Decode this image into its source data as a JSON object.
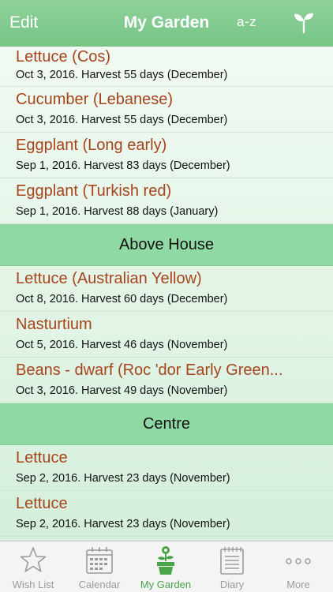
{
  "navbar": {
    "edit": "Edit",
    "title": "My Garden",
    "sort": "a-z"
  },
  "rows_top": [
    {
      "title": "Lettuce (Cos)",
      "sub": "Oct 3, 2016. Harvest 55 days (December)"
    },
    {
      "title": "Cucumber (Lebanese)",
      "sub": "Oct 3, 2016. Harvest 55 days (December)"
    },
    {
      "title": "Eggplant (Long early)",
      "sub": "Sep 1, 2016. Harvest 83 days (December)"
    },
    {
      "title": "Eggplant (Turkish red)",
      "sub": "Sep 1, 2016. Harvest 88 days (January)"
    }
  ],
  "section_above_house": {
    "header": "Above House",
    "rows": [
      {
        "title": "Lettuce (Australian Yellow)",
        "sub": "Oct 8, 2016. Harvest 60 days (December)"
      },
      {
        "title": "Nasturtium",
        "sub": "Oct 5, 2016. Harvest 46 days (November)"
      },
      {
        "title": "Beans - dwarf (Roc 'dor Early Green...",
        "sub": "Oct 3, 2016. Harvest 49 days (November)"
      }
    ]
  },
  "section_centre": {
    "header": "Centre",
    "rows": [
      {
        "title": "Lettuce",
        "sub": "Sep 2, 2016. Harvest 23 days (November)"
      },
      {
        "title": "Lettuce",
        "sub": "Sep 2, 2016. Harvest 23 days (November)"
      }
    ]
  },
  "tabs": [
    {
      "label": "Wish List",
      "icon": "star-icon"
    },
    {
      "label": "Calendar",
      "icon": "calendar-icon"
    },
    {
      "label": "My Garden",
      "icon": "plant-pot-icon",
      "active": true
    },
    {
      "label": "Diary",
      "icon": "notepad-icon"
    },
    {
      "label": "More",
      "icon": "more-dots-icon"
    }
  ],
  "colors": {
    "navbar": "#7fc98d",
    "title_text": "#a6441c",
    "section": "#8fdaa4",
    "active_tab": "#4aa548"
  }
}
